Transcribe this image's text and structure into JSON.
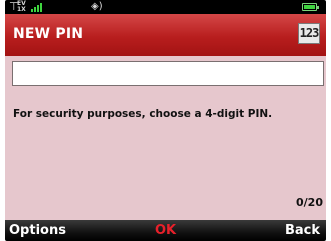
{
  "status_bar": {
    "signal_icon": "antenna-icon",
    "network_label": "EV",
    "network_sub": "1X",
    "sound_icon": "speaker-icon",
    "battery_icon": "battery-icon",
    "signal_color": "#3fd63f"
  },
  "header": {
    "title": "NEW PIN",
    "input_mode": "123"
  },
  "form": {
    "pin_value": "",
    "instruction": "For security purposes, choose a 4-digit PIN.",
    "char_counter": "0/20"
  },
  "softkeys": {
    "left": "Options",
    "center": "OK",
    "right": "Back",
    "center_color": "#e8202a"
  },
  "colors": {
    "title_bar": "#b81e1e",
    "content_bg": "#e6c7cd",
    "softkey_bar": "#000000"
  }
}
